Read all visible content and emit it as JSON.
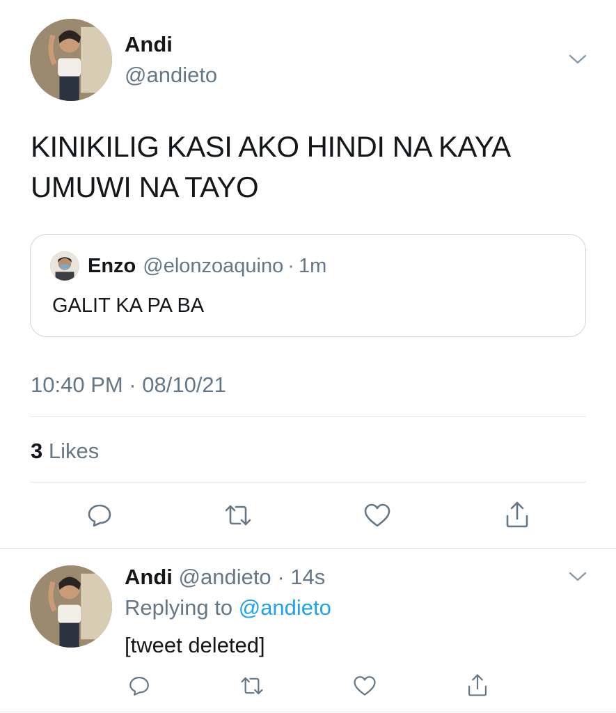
{
  "main_tweet": {
    "author_name": "Andi",
    "author_handle": "@andieto",
    "text_line1": "KINIKILIG KASI AKO HINDI NA KAYA",
    "text_line2": "UMUWI NA TAYO",
    "quoted": {
      "name": "Enzo",
      "handle": "@elonzoaquino",
      "separator": "·",
      "time": "1m",
      "text": "GALIT KA PA BA"
    },
    "timestamp": "10:40 PM · 08/10/21",
    "likes_count": "3",
    "likes_label": "Likes"
  },
  "reply_tweet": {
    "author_name": "Andi",
    "author_handle": "@andieto",
    "separator": "·",
    "time": "14s",
    "replying_to_label": "Replying to",
    "replying_to_handle": "@andieto",
    "text": "[tweet deleted]"
  },
  "icons": {
    "reply": "reply-icon",
    "retweet": "retweet-icon",
    "like": "heart-icon",
    "share": "share-icon",
    "menu": "chevron-down-icon"
  },
  "colors": {
    "text": "#14171a",
    "secondary": "#657786",
    "link": "#1da1f2",
    "divider": "#e1e8ed"
  }
}
